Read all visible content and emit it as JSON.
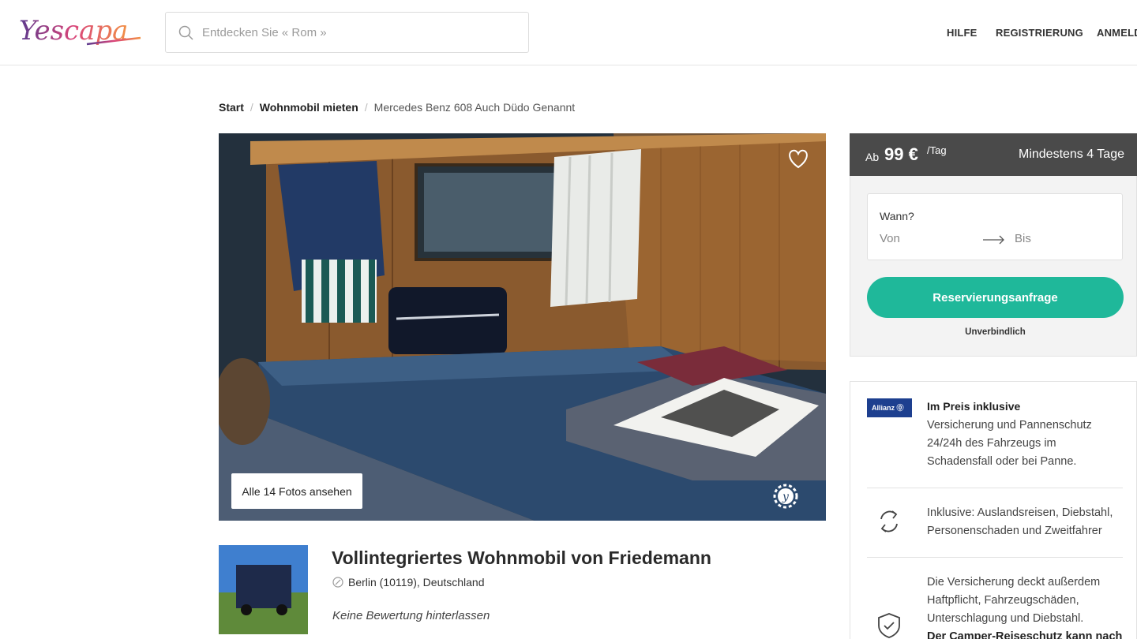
{
  "brand": {
    "name": "Yescapa",
    "logo_icon": "yescapa-logo"
  },
  "search": {
    "placeholder": "Entdecken Sie « Rom »",
    "icon": "search-icon"
  },
  "nav": {
    "help": "HILFE",
    "register": "REGISTRIERUNG",
    "login": "ANMELD"
  },
  "breadcrumb": {
    "start": "Start",
    "category": "Wohnmobil mieten",
    "current": "Mercedes Benz 608 Auch Düdo Genannt"
  },
  "gallery": {
    "all_photos_label": "Alle 14 Fotos ansehen",
    "favorite_icon": "heart-icon"
  },
  "listing": {
    "title": "Vollintegriertes Wohnmobil von Friedemann",
    "location": "Berlin (10119), Deutschland",
    "no_review": "Keine Bewertung hinterlassen"
  },
  "price": {
    "prefix": "Ab",
    "amount": "99 €",
    "unit": "/Tag",
    "minimum": "Mindestens 4 Tage"
  },
  "booking": {
    "when_label": "Wann?",
    "from_label": "Von",
    "to_label": "Bis",
    "reserve_button": "Reservierungsanfrage",
    "non_binding": "Unverbindlich"
  },
  "insurance": {
    "partner": "Allianz ⓪",
    "title": "Im Preis inklusive",
    "line1": "Versicherung und Pannenschutz 24/24h des Fahrzeugs im Schadensfall oder bei Panne.",
    "line2": "Inklusive: Auslandsreisen, Diebstahl, Personenschaden und Zweitfahrer",
    "line3": "Die Versicherung deckt außerdem Haftpflicht, Fahrzeugschäden, Unterschlagung und Diebstahl.",
    "line4": "Der Camper-Reiseschutz kann nach"
  },
  "colors": {
    "accent": "#1fb89a",
    "price_header": "#4a4a4a",
    "allianz_blue": "#1d3f8f"
  }
}
